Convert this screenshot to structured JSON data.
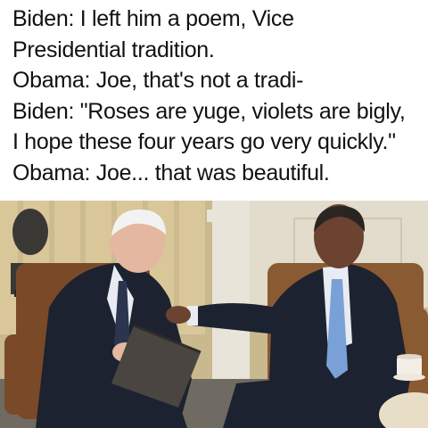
{
  "caption": {
    "lines": [
      "Biden: I left him a poem, Vice",
      "Presidential tradition.",
      "Obama: Joe, that's not a tradi-",
      "Biden: \"Roses are yuge, violets are bigly,",
      "I hope these four years go very quickly.\"",
      "Obama: Joe... that was beautiful."
    ]
  },
  "photo": {
    "colors": {
      "wall": "#c9b98f",
      "curtain": "#d9c79a",
      "chair_left": "#7a4a28",
      "chair_right": "#8a5a33",
      "suit": "#1c2230",
      "shirt": "#e8ecf2",
      "tie_left": "#2b3550",
      "tie_right": "#7aa0d8",
      "skin_left": "#e3b7a0",
      "skin_right": "#6b4330",
      "hair_left": "#f2f2f2",
      "hair_right": "#2a2520",
      "folder": "#4a4540",
      "bust": "#3a3835",
      "column": "#e9e4da"
    }
  }
}
